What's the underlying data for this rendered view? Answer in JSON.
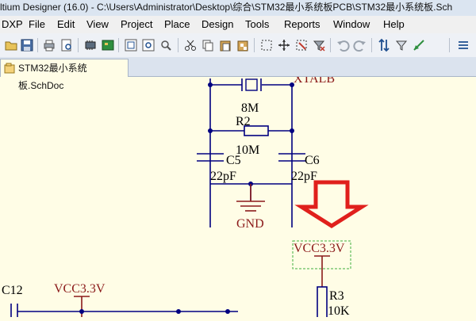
{
  "window": {
    "title": "ltium Designer (16.0) - C:\\Users\\Administrator\\Desktop\\综合\\STM32最小系统板PCB\\STM32最小系统板.Sch"
  },
  "menu": {
    "items": [
      "DXP",
      "File",
      "Edit",
      "View",
      "Project",
      "Place",
      "Design",
      "Tools",
      "Reports",
      "Window",
      "Help"
    ]
  },
  "toolbar": {
    "icons": [
      "folder-open-icon",
      "save-icon",
      "print-icon",
      "print-preview-icon",
      "component-icon",
      "pcb-icon",
      "zoom-fit-icon",
      "zoom-area-icon",
      "zoom-selected-icon",
      "cut-icon",
      "copy-icon",
      "paste-icon",
      "paste-array-icon",
      "select-area-icon",
      "move-icon",
      "deselect-icon",
      "undo-icon",
      "redo-icon",
      "cross-probe-icon",
      "filter-icon",
      "browse-icon"
    ]
  },
  "tab": {
    "label": "STM32最小系统板.SchDoc"
  },
  "schematic": {
    "net_label_top": "XTALB",
    "crystal_value": "8M",
    "resistor_r2": "R2",
    "resistor_r2_value": "10M",
    "cap_c5": "C5",
    "cap_c5_value": "22pF",
    "cap_c6": "C6",
    "cap_c6_value": "22pF",
    "gnd_label": "GND",
    "vcc_right": "VCC3.3V",
    "resistor_r3": "R3",
    "resistor_r3_value": "10K",
    "cap_c12": "C12",
    "vcc_left": "VCC3.3V"
  },
  "colors": {
    "wire": "#000080",
    "power": "#8b1a1a",
    "annotation_arrow": "#e0201c",
    "selection_box": "#3fae3f"
  }
}
